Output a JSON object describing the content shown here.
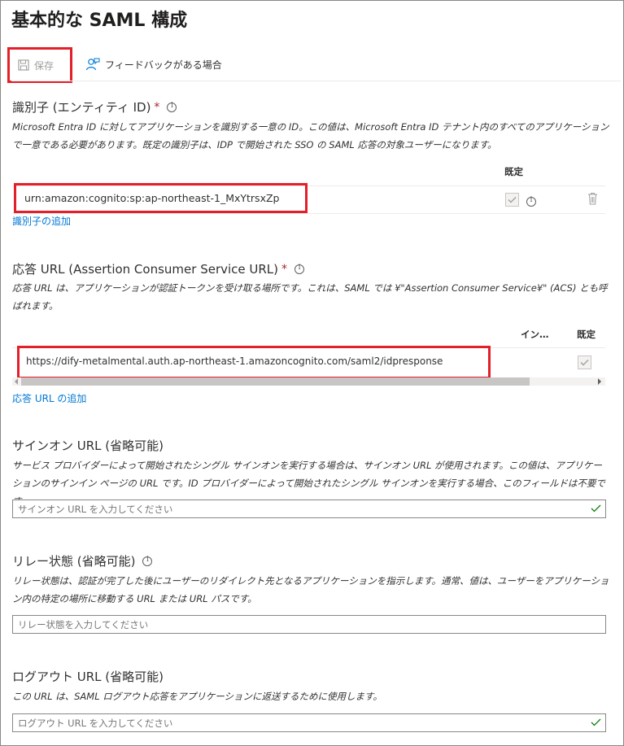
{
  "page_title": "基本的な SAML 構成",
  "toolbar": {
    "save_label": "保存",
    "feedback_label": "フィードバックがある場合"
  },
  "identifier": {
    "title": "識別子 (エンティティ ID)",
    "required_mark": "*",
    "description": "Microsoft Entra ID に対してアプリケーションを識別する一意の ID。この値は、Microsoft Entra ID テナント内のすべてのアプリケーションで一意である必要があります。既定の識別子は、IDP で開始された SSO の SAML 応答の対象ユーザーになります。",
    "column_default": "既定",
    "value": "urn:amazon:cognito:sp:ap-northeast-1_MxYtrsxZp",
    "add_link": "識別子の追加"
  },
  "reply_url": {
    "title": "応答 URL (Assertion Consumer Service URL)",
    "required_mark": "*",
    "description": "応答 URL は、アプリケーションが認証トークンを受け取る場所です。これは、SAML では ¥\"Assertion Consumer Service¥\" (ACS) とも呼ばれます。",
    "column_index": "イン…",
    "column_default": "既定",
    "value": "https://dify-metalmental.auth.ap-northeast-1.amazoncognito.com/saml2/idpresponse",
    "add_link": "応答 URL の追加"
  },
  "sign_on_url": {
    "title": "サインオン URL (省略可能)",
    "description": "サービス プロバイダーによって開始されたシングル サインオンを実行する場合は、サインオン URL が使用されます。この値は、アプリケーションのサインイン ページの URL です。ID プロバイダーによって開始されたシングル サインオンを実行する場合、このフィールドは不要です。",
    "placeholder": "サインオン URL を入力してください"
  },
  "relay_state": {
    "title": "リレー状態 (省略可能)",
    "description": "リレー状態は、認証が完了した後にユーザーのリダイレクト先となるアプリケーションを指示します。通常、値は、ユーザーをアプリケーション内の特定の場所に移動する URL または URL パスです。",
    "placeholder": "リレー状態を入力してください"
  },
  "logout_url": {
    "title": "ログアウト URL (省略可能)",
    "description": "この URL は、SAML ログアウト応答をアプリケーションに返送するために使用します。",
    "placeholder": "ログアウト URL を入力してください"
  },
  "colors": {
    "accent": "#0078d4",
    "highlight_border": "#e3202a",
    "required": "#a4262c",
    "valid_check": "#107c10"
  }
}
